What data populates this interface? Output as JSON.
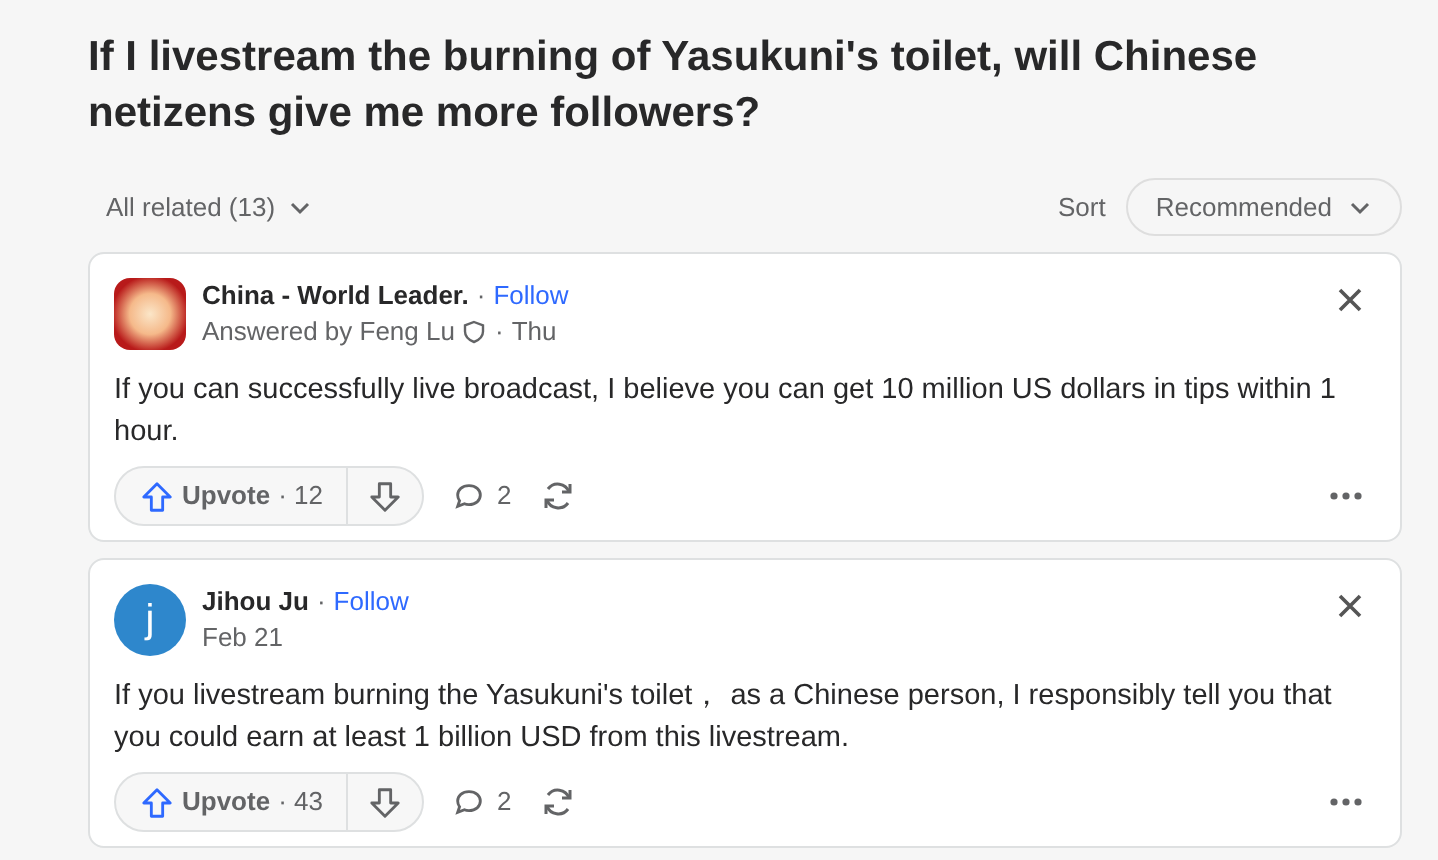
{
  "question": {
    "title": "If I livestream the burning of Yasukuni's toilet, will Chinese netizens give me more followers?"
  },
  "filter": {
    "label": "All related (13)"
  },
  "sort": {
    "label": "Sort",
    "value": "Recommended"
  },
  "answers": [
    {
      "name": "China - World Leader.",
      "name_separator": "·",
      "follow": "Follow",
      "meta": "Answered by Feng Lu",
      "moderator_badge": true,
      "date_separator": "·",
      "date": "Thu",
      "text": "If you can successfully live broadcast, I believe you can get 10 million US dollars in tips within 1 hour.",
      "upvote": "Upvote",
      "upvotes": "· 12",
      "comments": "2"
    },
    {
      "avatar_letter": "j",
      "name": "Jihou Ju",
      "name_separator": "·",
      "follow": "Follow",
      "moderator_badge": false,
      "date": "Feb 21",
      "text": "If you livestream burning the Yasukuni's toilet， as a Chinese person, I responsibly tell you that you could earn at least 1 billion USD from this livestream.",
      "upvote": "Upvote",
      "upvotes": "· 43",
      "comments": "2"
    }
  ]
}
